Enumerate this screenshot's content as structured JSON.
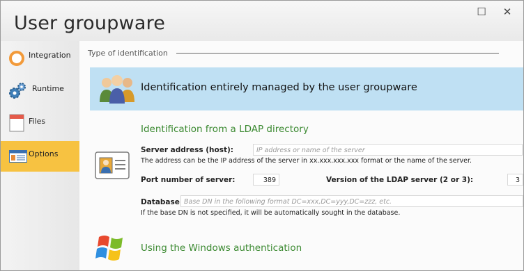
{
  "window": {
    "title": "User groupware",
    "maximize_glyph": "☐",
    "close_glyph": "✕"
  },
  "sidebar": {
    "items": [
      {
        "label": "Integration",
        "icon": "orange-ring-icon"
      },
      {
        "label": "Runtime",
        "icon": "gears-icon"
      },
      {
        "label": "Files",
        "icon": "file-icon"
      },
      {
        "label": "Options",
        "icon": "options-list-icon",
        "active": true
      }
    ]
  },
  "main": {
    "section_title": "Type of identification",
    "option_groupware": "Identification entirely managed by the user groupware",
    "ldap": {
      "title": "Identification from a LDAP directory",
      "server_label": "Server address (host):",
      "server_placeholder": "IP address or name of the server",
      "server_help": "The address can be the IP address of the server in xx.xxx.xxx.xxx format or the name of the server.",
      "port_label": "Port number of server:",
      "port_value": "389",
      "version_label": "Version of the LDAP server (2 or 3):",
      "version_value": "3",
      "database_label": "Database:",
      "database_placeholder": "Base DN in the following format DC=xxx,DC=yyy,DC=zzz, etc.",
      "database_help": "If the base DN is not specified, it will be automatically sought in the database."
    },
    "windows_auth": "Using the Windows authentication"
  },
  "colors": {
    "accent_selected": "#f7c241",
    "highlight_blue": "#bfe0f3",
    "green_heading": "#3c8a32"
  }
}
